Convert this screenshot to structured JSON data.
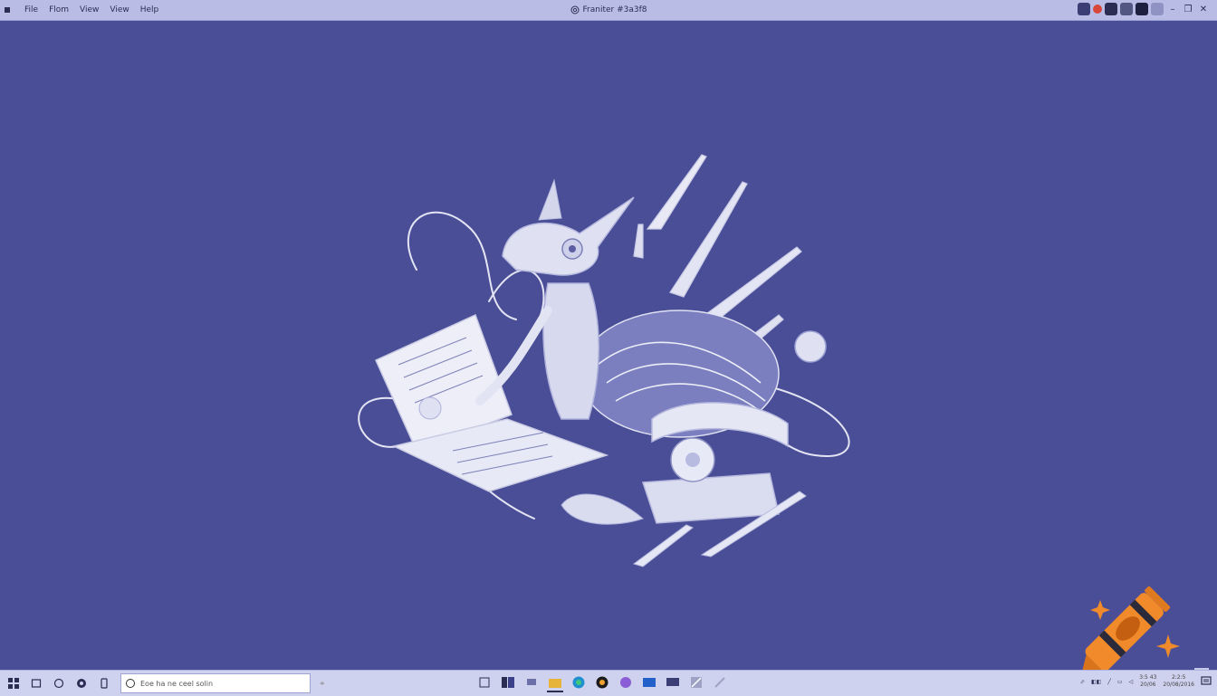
{
  "menu": {
    "items": [
      "File",
      "Flom",
      "View",
      "View",
      "Help"
    ]
  },
  "window": {
    "title": "Franiter #3a3f8"
  },
  "taskbar": {
    "search_placeholder": "Eoe ha ne ceel solin",
    "search_extra": "≑",
    "clock_time": "3:5 43",
    "clock_date": "20/06",
    "clock_time2": "2:2:5",
    "clock_date2": "20/08/2016"
  },
  "colors": {
    "desktop_bg": "#4a4e96",
    "titlebar_bg": "#b9bde6",
    "taskbar_bg": "#cfd2ee",
    "accent_orange": "#f08a2a"
  },
  "icons": {
    "title": "copyright-icon",
    "desktop_art": "robot-creature-sketch",
    "logo": "crayon-icon",
    "trash": "recycle-bin-icon"
  }
}
